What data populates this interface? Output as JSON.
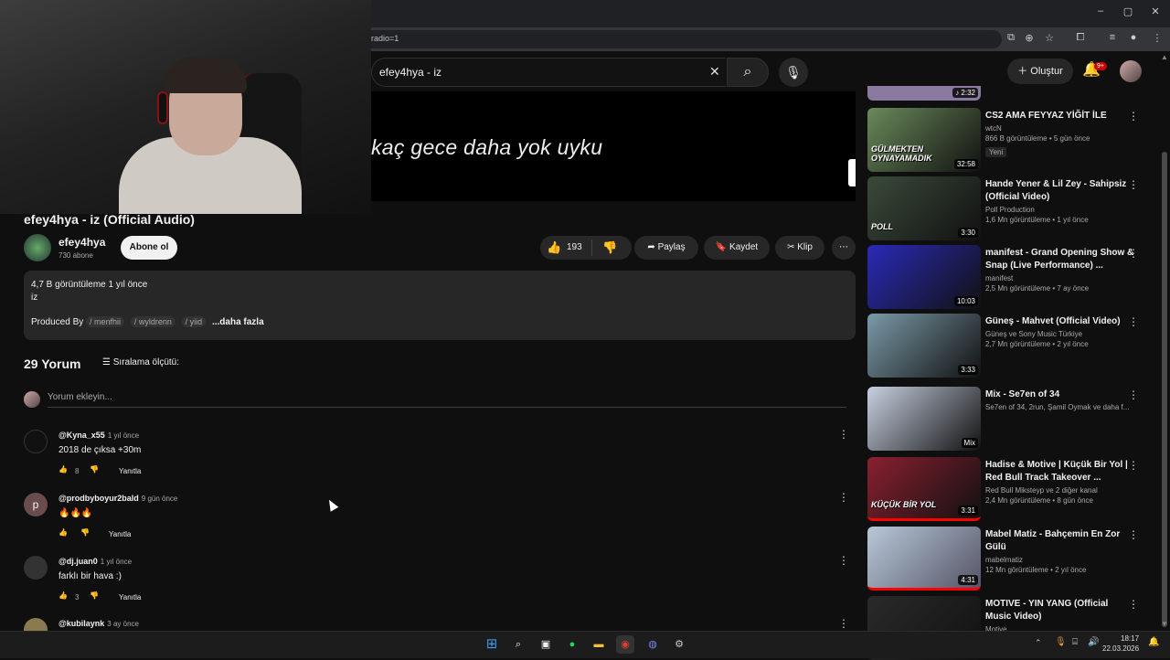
{
  "browser": {
    "url": "radio=1",
    "window_controls": [
      "–",
      "▢",
      "✕"
    ]
  },
  "header": {
    "search_value": "efey4hya - iz",
    "create_label": "Oluştur",
    "notification_badge": "9+"
  },
  "player": {
    "lyric": "kaç gece daha yok uyku"
  },
  "video": {
    "title": "efey4hya - iz (Official Audio)",
    "channel": "efey4hya",
    "subscribers": "730 abone",
    "subscribe_label": "Abone ol",
    "likes": "193",
    "share_label": "Paylaş",
    "save_label": "Kaydet",
    "clip_label": "Klip"
  },
  "description": {
    "stats": "4,7 B görüntüleme  1 yıl önce",
    "line1": "iz",
    "produced_by": "Produced By",
    "tags": [
      "/ menfhii",
      "/ wyldrenn",
      "/ yiid"
    ],
    "more": "...daha fazla"
  },
  "comments": {
    "count_label": "29 Yorum",
    "sort_label": "Sıralama ölçütü:",
    "input_placeholder": "Yorum ekleyin...",
    "reply_label": "Yanıtla",
    "items": [
      {
        "handle": "@Kyna_x55",
        "time": "1 yıl önce",
        "text": "2018 de çıksa +30m",
        "likes": "8"
      },
      {
        "handle": "@prodbyboyur2bald",
        "time": "9 gün önce",
        "text": "🔥🔥🔥",
        "likes": ""
      },
      {
        "handle": "@dj.juan0",
        "time": "1 yıl önce",
        "text": "farklı bir hava :)",
        "likes": "3"
      },
      {
        "handle": "@kubilaynk",
        "time": "3 ay önce",
        "text": "",
        "likes": ""
      }
    ]
  },
  "sidebar": {
    "top_duration": "2:32",
    "items": [
      {
        "title": "CS2 AMA FEYYAZ YİĞİT İLE",
        "channel": "wtcN",
        "meta": "866 B görüntüleme • 5 gün önce",
        "badge": "Yeni",
        "duration": "32:58",
        "thumb_text": "GÜLMEKTEN OYNAYAMADIK",
        "color": "#6a8a5a"
      },
      {
        "title": "Hande Yener & Lil Zey - Sahipsiz (Official Video)",
        "channel": "Poll Production",
        "meta": "1,6 Mn görüntüleme • 1 yıl önce",
        "badge": "",
        "duration": "3:30",
        "thumb_text": "POLL",
        "color": "#3a4a3a"
      },
      {
        "title": "manifest - Grand Opening Show & Snap (Live Performance) ...",
        "channel": "manifest",
        "meta": "2,5 Mn görüntüleme • 7 ay önce",
        "badge": "",
        "duration": "10:03",
        "thumb_text": "",
        "color": "#2a2ab8"
      },
      {
        "title": "Güneş - Mahvet (Official Video)",
        "channel": "Güneş  ve Sony Music Türkiye",
        "meta": "2,7 Mn görüntüleme • 2 yıl önce",
        "badge": "",
        "duration": "3:33",
        "thumb_text": "",
        "color": "#7a9aa8"
      },
      {
        "title": "Mix - Se7en of 34",
        "channel": "Se7en of 34, 2run, Şamil Oymak ve daha f...",
        "meta": "",
        "badge": "",
        "duration": "Mix",
        "thumb_text": "",
        "color": "#c8d0e0"
      },
      {
        "title": "Hadise & Motive | Küçük Bir Yol | Red Bull Track Takeover ...",
        "channel": "Red Bull Miksteyp  ve 2 diğer kanal",
        "meta": "2,4 Mn görüntüleme • 8 gün önce",
        "badge": "",
        "duration": "3:31",
        "thumb_text": "KÜÇÜK BİR YOL",
        "color": "#8a2030"
      },
      {
        "title": "Mabel Matiz - Bahçemin En Zor Gülü",
        "channel": "mabelmatiz",
        "meta": "12 Mn görüntüleme • 2 yıl önce",
        "badge": "",
        "duration": "4:31",
        "thumb_text": "",
        "color": "#9ab0c0"
      },
      {
        "title": "MOTIVE - YIN YANG (Official Music Video)",
        "channel": "Motive",
        "meta": "",
        "badge": "",
        "duration": "",
        "thumb_text": "",
        "color": "#2a2a2a"
      }
    ]
  },
  "taskbar": {
    "time": "18:17",
    "date": "22.03.2026"
  }
}
